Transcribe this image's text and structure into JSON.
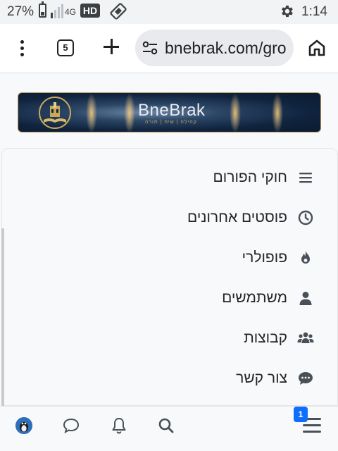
{
  "status_bar": {
    "battery_percent": "27%",
    "network": "4G",
    "hd_badge": "HD",
    "time": "1:14"
  },
  "browser": {
    "tab_count": "5",
    "url": "bnebrak.com/gro"
  },
  "banner": {
    "title": "BneBrak",
    "subtitle": "קהילה | שיח | תורה"
  },
  "menu": {
    "items": [
      {
        "label": "חוקי הפורום",
        "icon": "list-icon"
      },
      {
        "label": "פוסטים אחרונים",
        "icon": "clock-icon"
      },
      {
        "label": "פופולרי",
        "icon": "fire-icon"
      },
      {
        "label": "משתמשים",
        "icon": "user-icon"
      },
      {
        "label": "קבוצות",
        "icon": "users-icon"
      },
      {
        "label": "צור קשר",
        "icon": "chat-icon"
      }
    ]
  },
  "bottom_nav": {
    "badge_count": "1"
  },
  "colors": {
    "accent": "#0d6efd",
    "banner_bg": "#10243f",
    "banner_gold": "#c9a85a"
  }
}
